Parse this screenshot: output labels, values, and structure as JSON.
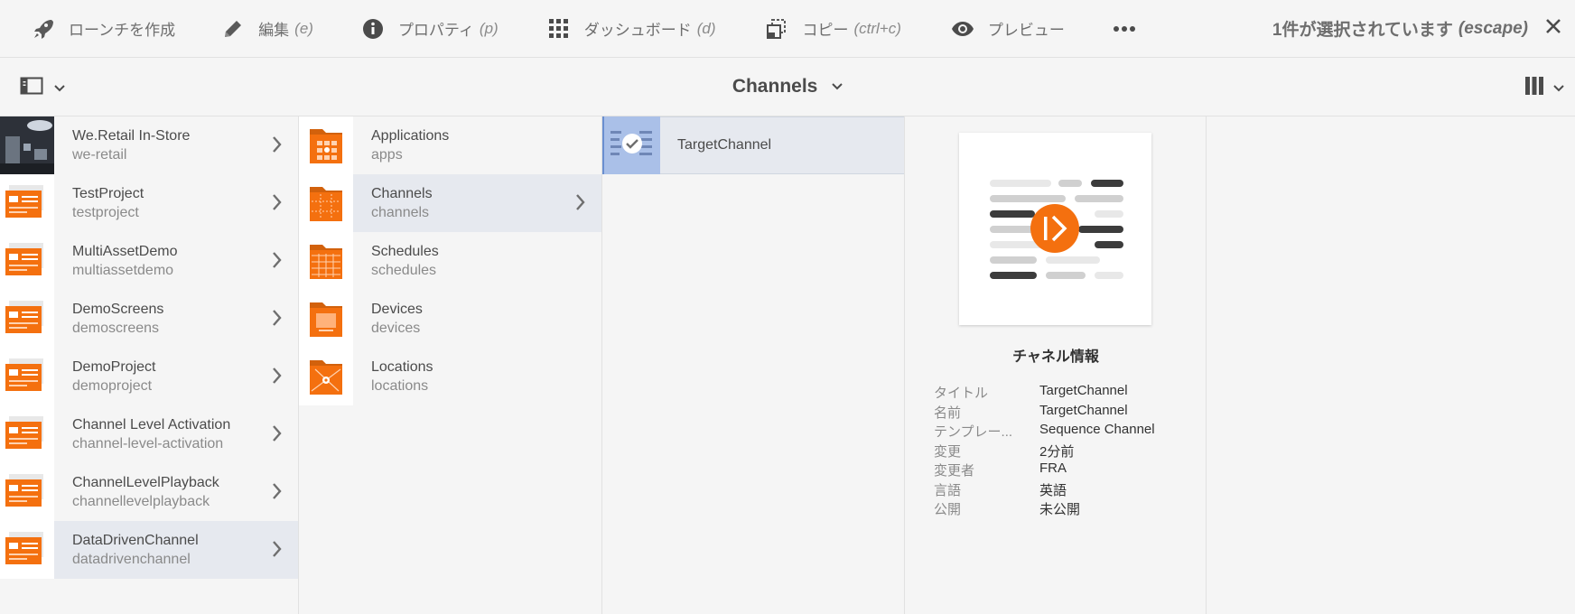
{
  "toolbar": {
    "actions": [
      {
        "label": "ローンチを作成",
        "shortcut": "",
        "icon": "rocket-icon"
      },
      {
        "label": "編集",
        "shortcut": "(e)",
        "icon": "pencil-icon"
      },
      {
        "label": "プロパティ",
        "shortcut": "(p)",
        "icon": "info-icon"
      },
      {
        "label": "ダッシュボード",
        "shortcut": "(d)",
        "icon": "grid-icon"
      },
      {
        "label": "コピー",
        "shortcut": "(ctrl+c)",
        "icon": "copy-icon"
      },
      {
        "label": "プレビュー",
        "shortcut": "",
        "icon": "eye-icon"
      }
    ],
    "more_icon": "ellipsis-icon",
    "selection_text": "1件が選択されています",
    "selection_shortcut": "(escape)"
  },
  "subbar": {
    "breadcrumb": "Channels"
  },
  "column1": [
    {
      "title": "We.Retail In-Store",
      "name": "we-retail"
    },
    {
      "title": "TestProject",
      "name": "testproject"
    },
    {
      "title": "MultiAssetDemo",
      "name": "multiassetdemo"
    },
    {
      "title": "DemoScreens",
      "name": "demoscreens"
    },
    {
      "title": "DemoProject",
      "name": "demoproject"
    },
    {
      "title": "Channel Level Activation",
      "name": "channel-level-activation"
    },
    {
      "title": "ChannelLevelPlayback",
      "name": "channellevelplayback"
    },
    {
      "title": "DataDrivenChannel",
      "name": "datadrivenchannel"
    }
  ],
  "column2": [
    {
      "title": "Applications",
      "name": "apps"
    },
    {
      "title": "Channels",
      "name": "channels"
    },
    {
      "title": "Schedules",
      "name": "schedules"
    },
    {
      "title": "Devices",
      "name": "devices"
    },
    {
      "title": "Locations",
      "name": "locations"
    }
  ],
  "column3": [
    {
      "title": "TargetChannel"
    }
  ],
  "details": {
    "heading": "チャネル情報",
    "rows": [
      {
        "key": "タイトル",
        "value": "TargetChannel"
      },
      {
        "key": "名前",
        "value": "TargetChannel"
      },
      {
        "key": "テンプレー...",
        "value": "Sequence Channel"
      },
      {
        "key": "変更",
        "value": "2分前"
      },
      {
        "key": "変更者",
        "value": "FRA"
      },
      {
        "key": "言語",
        "value": "英語"
      },
      {
        "key": "公開",
        "value": "未公開"
      }
    ]
  },
  "colors": {
    "accent_orange": "#f4700f",
    "selected_row": "#e6e9ef",
    "selected_thumb": "#aac0e8"
  }
}
